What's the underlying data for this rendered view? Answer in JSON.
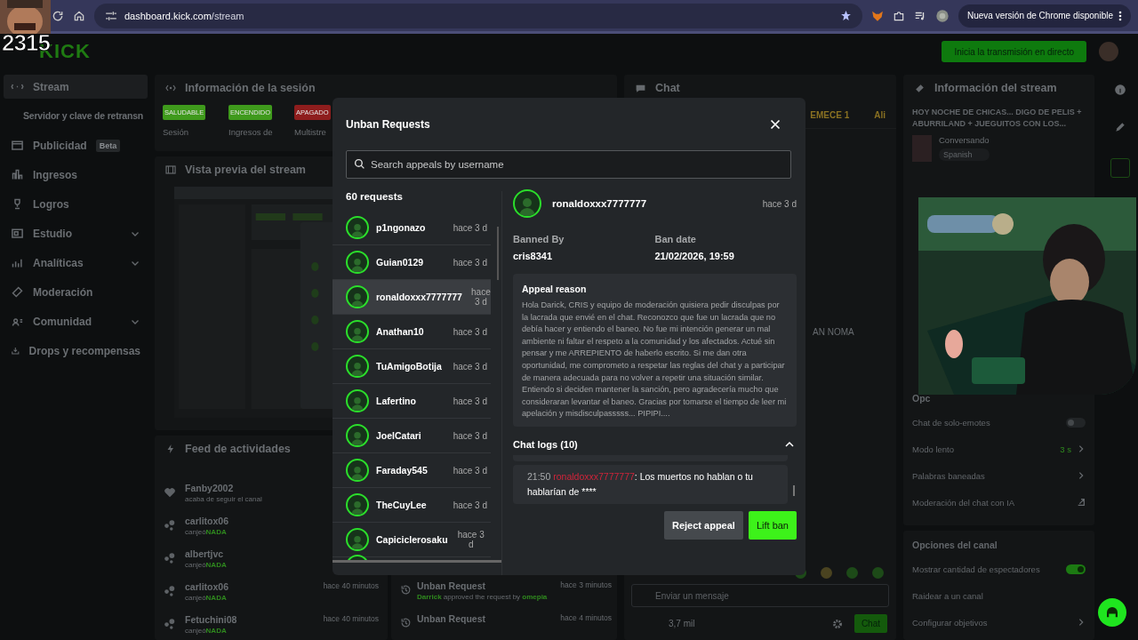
{
  "browser": {
    "url_host": "dashboard.kick.com",
    "url_path": "/stream",
    "update_notice": "Nueva versión de Chrome disponible"
  },
  "stream_overlay": {
    "counter": "2315"
  },
  "header": {
    "logo": "KICK",
    "live_button": "Inicia la transmisión en directo"
  },
  "sidebar": {
    "items": [
      {
        "label": "Stream",
        "kind": "item",
        "selected": true
      },
      {
        "label": "Servidor y clave de retransn",
        "kind": "sub",
        "selected": false
      },
      {
        "label": "Publicidad",
        "kind": "item",
        "selected": false,
        "badge": "Beta"
      },
      {
        "label": "Ingresos",
        "kind": "item",
        "selected": false
      },
      {
        "label": "Logros",
        "kind": "item",
        "selected": false
      },
      {
        "label": "Estudio",
        "kind": "item",
        "selected": false,
        "expandable": true
      },
      {
        "label": "Analíticas",
        "kind": "item",
        "selected": false,
        "expandable": true
      },
      {
        "label": "Moderación",
        "kind": "item",
        "selected": false
      },
      {
        "label": "Comunidad",
        "kind": "item",
        "selected": false,
        "expandable": true
      },
      {
        "label": "Drops y recompensas",
        "kind": "item",
        "selected": false
      }
    ]
  },
  "session": {
    "title": "Información de la sesión",
    "statuses": [
      {
        "label": "SALUDABLE",
        "caption": "Sesión",
        "color": "#3f9a1c"
      },
      {
        "label": "ENCENDIDO",
        "caption": "Ingresos de",
        "color": "#3f9a1c"
      },
      {
        "label": "APAGADO",
        "caption": "Multistre",
        "color": "#8e1d1d"
      }
    ]
  },
  "preview": {
    "title": "Vista previa del stream"
  },
  "feed": {
    "title": "Feed de actividades",
    "items": [
      {
        "kind": "follow",
        "user": "Fanby2002",
        "action": "acaba de seguir el canal"
      },
      {
        "kind": "redeem",
        "user": "carlitox06",
        "action": "canjeó",
        "reward": "NADA"
      },
      {
        "kind": "redeem",
        "user": "albertjvc",
        "action": "canjeó",
        "reward": "NADA"
      },
      {
        "kind": "redeem",
        "user": "carlitox06",
        "action": "canjeó",
        "reward": "NADA",
        "time": "hace 40 minutos"
      },
      {
        "kind": "redeem",
        "user": "Fetuchini08",
        "action": "canjeó",
        "reward": "NADA",
        "time": "hace 40 minutos"
      }
    ]
  },
  "mod_log": {
    "items": [
      {
        "title": "Unban Request",
        "time": "hace 3 minutos",
        "moderator": "Darrick",
        "detail": "approved the request by",
        "target": "omepia"
      },
      {
        "title": "Unban Request",
        "time": "hace 4 minutos"
      }
    ]
  },
  "chat": {
    "title": "Chat",
    "pinned": [
      "EMECE 1",
      "Ali"
    ],
    "message_fragment": "AN NOMA",
    "placeholder": "Enviar un mensaje",
    "viewers": "3,7 mil",
    "send_button": "Chat"
  },
  "stream_info": {
    "title": "Información del stream",
    "stream_title": "HOY NOCHE DE CHICAS... DIGO DE PELIS + ABURRILAND + JUEGUITOS CON LOS...",
    "category": "Conversando",
    "language": "Spanish"
  },
  "chat_settings": {
    "title": "Opc",
    "items": [
      {
        "label": "Chat de solo-emotes",
        "kind": "toggle",
        "on": false
      },
      {
        "label": "Modo lento",
        "kind": "link",
        "value": "3 s"
      },
      {
        "label": "Palabras baneadas",
        "kind": "link"
      },
      {
        "label": "Moderación del chat con IA",
        "kind": "external"
      }
    ]
  },
  "channel_options": {
    "title": "Opciones del canal",
    "items": [
      {
        "label": "Mostrar cantidad de espectadores",
        "kind": "toggle",
        "on": true
      },
      {
        "label": "Raidear a un canal",
        "kind": "plain"
      },
      {
        "label": "Configurar objetivos",
        "kind": "link"
      }
    ]
  },
  "modal": {
    "title": "Unban Requests",
    "search_placeholder": "Search appeals by username",
    "count": "60 requests",
    "requests": [
      {
        "name": "p1ngonazo",
        "time": "hace 3 d",
        "selected": false
      },
      {
        "name": "Guian0129",
        "time": "hace 3 d",
        "selected": false
      },
      {
        "name": "ronaldoxxx7777777",
        "time": "hace 3 d",
        "selected": true
      },
      {
        "name": "Anathan10",
        "time": "hace 3 d",
        "selected": false
      },
      {
        "name": "TuAmigoBotija",
        "time": "hace 3 d",
        "selected": false
      },
      {
        "name": "Lafertino",
        "time": "hace 3 d",
        "selected": false
      },
      {
        "name": "JoelCatari",
        "time": "hace 3 d",
        "selected": false
      },
      {
        "name": "Faraday545",
        "time": "hace 3 d",
        "selected": false
      },
      {
        "name": "TheCuyLee",
        "time": "hace 3 d",
        "selected": false
      },
      {
        "name": "Capiciclerosaku",
        "time": "hace 3 d",
        "selected": false
      }
    ],
    "detail": {
      "name": "ronaldoxxx7777777",
      "time": "hace 3 d",
      "banned_by_label": "Banned By",
      "banned_by": "cris8341",
      "ban_date_label": "Ban date",
      "ban_date": "21/02/2026, 19:59",
      "appeal_title": "Appeal reason",
      "appeal_text": "Hola Darick, CRIS y equipo de moderación quisiera pedir disculpas por la lacrada que envié en el chat. Reconozco que fue un lacrada que no debía hacer y entiendo el baneo. No fue mi intención generar un mal ambiente ni faltar el respeto a la comunidad y los afectados. Actué sin pensar y me ARREPIENTO de haberlo escrito. Si me dan otra oportunidad, me comprometo a respetar las reglas del chat y a participar de manera adecuada para no volver a repetir una situación similar. Entiendo si deciden mantener la sanción, pero agradecería mucho que consideraran levantar el baneo. Gracias por tomarse el tiempo de leer mi apelación y misdisculpasssss... PIPIPI...."
    },
    "chat_logs": {
      "title": "Chat logs (10)",
      "expanded": true,
      "entries": [
        {
          "time": "21:50",
          "user": "ronaldoxxx7777777",
          "message": ": Los muertos no hablan o tu hablarían de ****"
        }
      ]
    },
    "reject_button": "Reject appeal",
    "lift_button": "Lift ban"
  }
}
